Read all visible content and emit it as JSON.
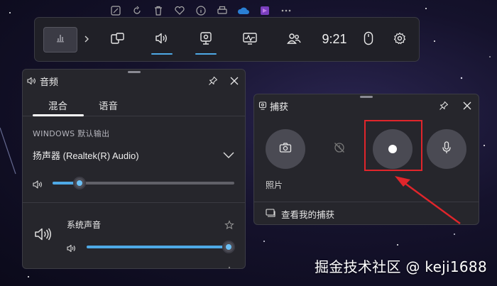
{
  "gamebar": {
    "time": "9:21"
  },
  "audio_panel": {
    "title": "音频",
    "tabs": [
      {
        "label": "混合",
        "selected": true
      },
      {
        "label": "语音",
        "selected": false
      }
    ],
    "output_caption": "WINDOWS 默认输出",
    "output_device": "扬声器 (Realtek(R) Audio)",
    "master_volume": 0.15,
    "apps": [
      {
        "label": "系统声音",
        "volume": 0.97
      }
    ]
  },
  "capture_panel": {
    "title": "捕获",
    "buttons": [
      {
        "name": "screenshot",
        "icon": "camera-icon"
      },
      {
        "name": "record-last-30s",
        "icon": "history-record-icon"
      },
      {
        "name": "start-recording",
        "icon": "record-dot-icon"
      },
      {
        "name": "microphone",
        "icon": "microphone-icon"
      }
    ],
    "caption": "照片",
    "view_captures_label": "查看我的捕获"
  },
  "annotation": {
    "color": "#e0252b"
  },
  "watermark": "掘金技术社区 @ keji1688",
  "colors": {
    "accent": "#4ea9e6",
    "panel_bg": "#26262c",
    "gamebar_bg": "#202027"
  }
}
